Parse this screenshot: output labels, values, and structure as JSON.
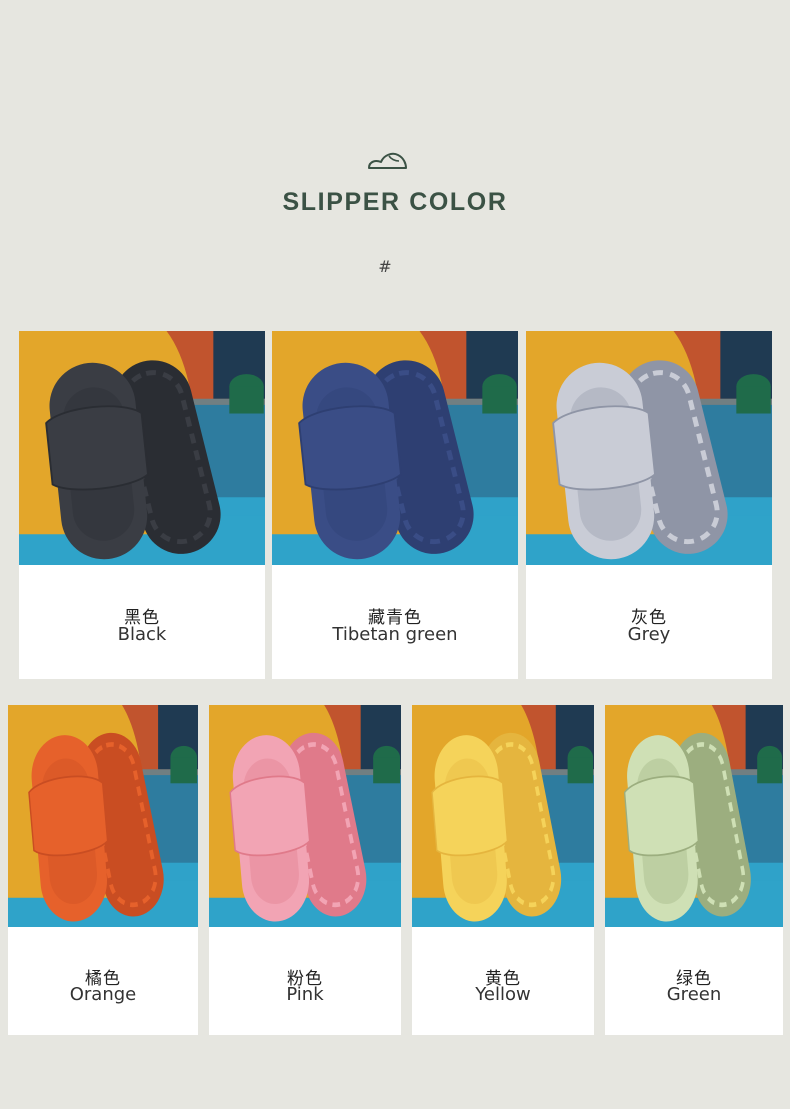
{
  "header": {
    "title": "SLIPPER COLOR",
    "hash": "#",
    "logo_icon": "slipper-outline-icon"
  },
  "colors": {
    "background": "#e6e6e0",
    "title": "#3b5245",
    "scene_table": "#2fa3c9",
    "scene_wall": "#e3a62a"
  },
  "products": [
    {
      "cn": "黑色",
      "en": "Black",
      "color": "#3a3d44",
      "sole": "#2a2d33"
    },
    {
      "cn": "藏青色",
      "en": "Tibetan green",
      "color": "#3a4d86",
      "sole": "#2e3f72"
    },
    {
      "cn": "灰色",
      "en": "Grey",
      "color": "#c9ccd6",
      "sole": "#8f95a6"
    },
    {
      "cn": "橘色",
      "en": "Orange",
      "color": "#e6612b",
      "sole": "#c94d22"
    },
    {
      "cn": "粉色",
      "en": "Pink",
      "color": "#f2a4b4",
      "sole": "#e07a8a"
    },
    {
      "cn": "黄色",
      "en": "Yellow",
      "color": "#f5d35a",
      "sole": "#e5b53e"
    },
    {
      "cn": "绿色",
      "en": "Green",
      "color": "#cfe0b5",
      "sole": "#9cae7f"
    }
  ]
}
